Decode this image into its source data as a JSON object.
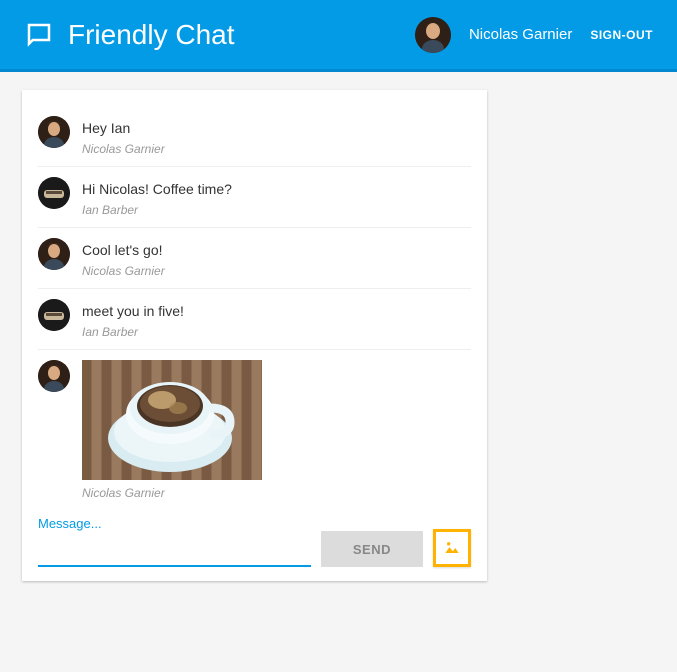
{
  "header": {
    "title": "Friendly Chat",
    "user": "Nicolas Garnier",
    "signout": "SIGN-OUT"
  },
  "avatars": {
    "nicolas": "nicolas",
    "ian": "ian"
  },
  "messages": [
    {
      "avatar": "nicolas",
      "text": "Hey Ian",
      "sender": "Nicolas Garnier",
      "type": "text"
    },
    {
      "avatar": "ian",
      "text": "Hi Nicolas! Coffee time?",
      "sender": "Ian Barber",
      "type": "text"
    },
    {
      "avatar": "nicolas",
      "text": "Cool let's go!",
      "sender": "Nicolas Garnier",
      "type": "text"
    },
    {
      "avatar": "ian",
      "text": "meet you in five!",
      "sender": "Ian Barber",
      "type": "text"
    },
    {
      "avatar": "nicolas",
      "text": "",
      "sender": "Nicolas Garnier",
      "type": "image"
    }
  ],
  "composer": {
    "label": "Message...",
    "send": "SEND"
  }
}
